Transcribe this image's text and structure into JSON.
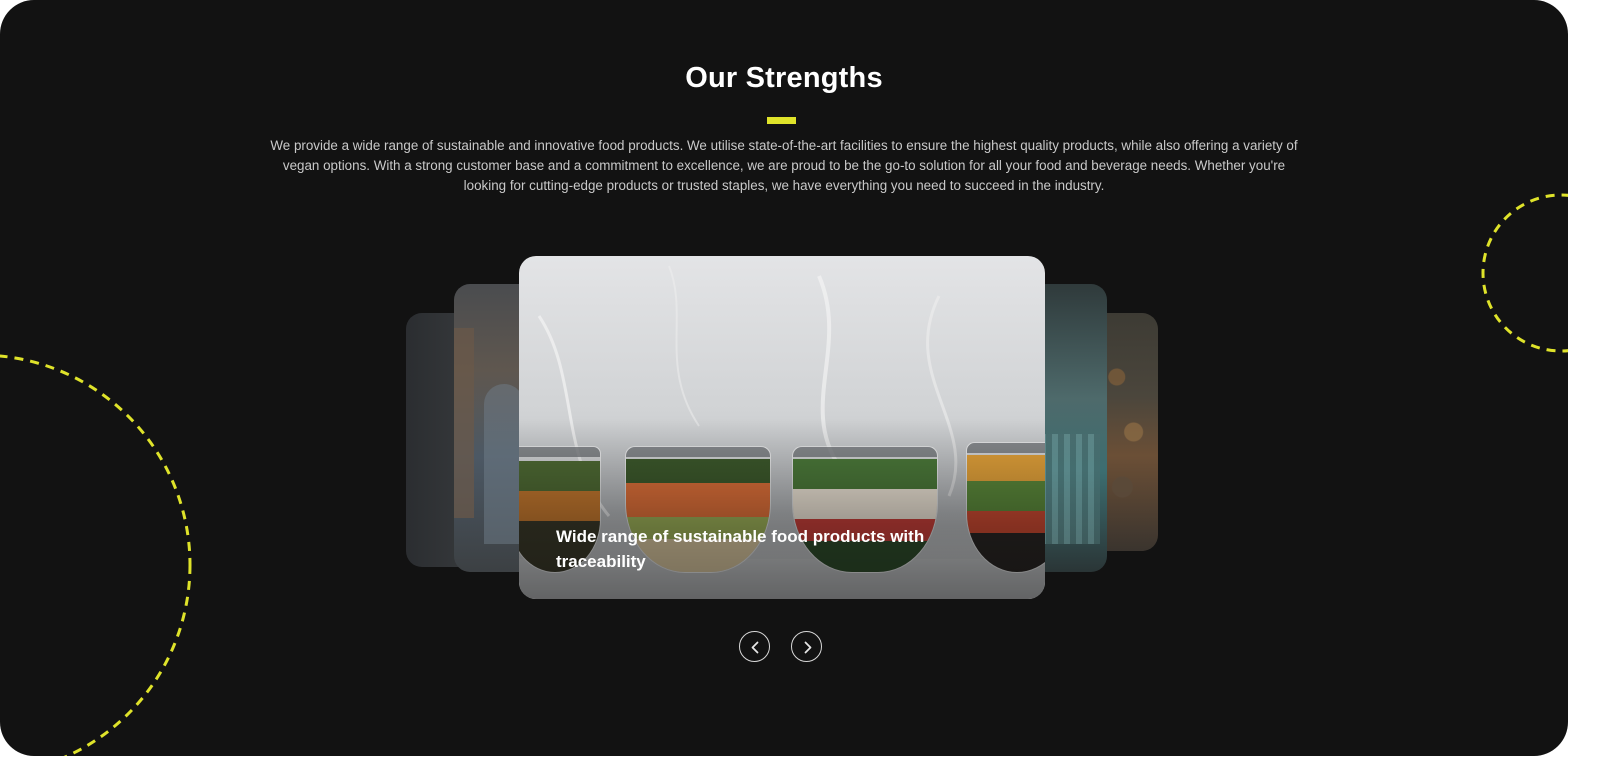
{
  "section": {
    "title": "Our Strengths",
    "description": "We provide a wide range of sustainable and innovative food products. We utilise state-of-the-art facilities to ensure the highest quality products, while also offering a variety of vegan options. With a strong customer base and a commitment to excellence, we are proud to be the go-to solution for all your food and beverage needs. Whether you're looking for cutting-edge products or trusted staples, we have everything you need to succeed in the industry.",
    "accent_color": "#dfe32a",
    "background_color": "#121212"
  },
  "carousel": {
    "active_caption": "Wide range of sustainable food products with traceability",
    "prev_icon": "chevron-left-icon",
    "next_icon": "chevron-right-icon"
  }
}
